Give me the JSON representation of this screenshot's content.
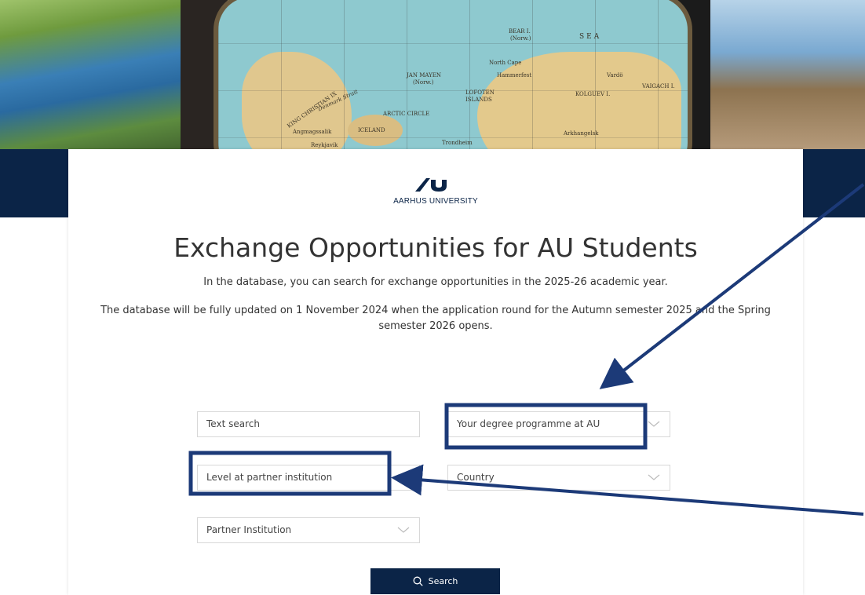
{
  "hero": {
    "map_labels": [
      "BEAR I.",
      "(Norw.)",
      "SEA",
      "JAN MAYEN",
      "(Norw.)",
      "North Cape",
      "Hammerfest",
      "Vardö",
      "LOFOTEN",
      "ISLANDS",
      "KOLGUEV I.",
      "VAIGACH I.",
      "KING CHRISTIAN IX",
      "Denmark Strait",
      "ARCTIC CIRCLE",
      "Angmagssalik",
      "ICELAND",
      "Reykjavik",
      "Trondheim",
      "Arkhangelsk"
    ]
  },
  "logo": {
    "text": "AARHUS UNIVERSITY"
  },
  "page": {
    "title": "Exchange Opportunities for AU Students",
    "intro": "In the database, you can search for exchange opportunities in the 2025-26 academic year.",
    "note": "The database will be fully updated on 1 November 2024 when the application round for the Autumn semester 2025 and the Spring semester 2026 opens."
  },
  "filters": {
    "text_search_placeholder": "Text search",
    "degree_programme": "Your degree programme at AU",
    "level": "Level at partner institution",
    "country": "Country",
    "partner_institution": "Partner Institution"
  },
  "search_button": {
    "label": "Search",
    "icon": "search-icon"
  },
  "colors": {
    "navy": "#0b2447",
    "annotation": "#1c3a78",
    "border": "#d8d8d8"
  }
}
